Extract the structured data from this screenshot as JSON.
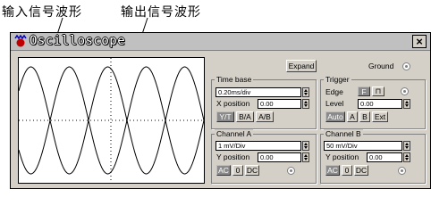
{
  "annotations": {
    "input_signal": "输入信号波形",
    "output_signal": "输出信号波形"
  },
  "window": {
    "title": "Oscilloscope",
    "close_label": "×"
  },
  "top": {
    "expand_label": "Expand",
    "ground_label": "Ground"
  },
  "timebase": {
    "title": "Time base",
    "value": "0.20ms/div",
    "x_position_label": "X position",
    "x_position_value": "0.00",
    "modes": [
      "Y/T",
      "B/A",
      "A/B"
    ],
    "active_mode": "Y/T"
  },
  "trigger": {
    "title": "Trigger",
    "edge_label": "Edge",
    "edge_rising": "F",
    "edge_falling": "⊓",
    "level_label": "Level",
    "level_value": "0.00",
    "sources": [
      "Auto",
      "A",
      "B",
      "Ext"
    ],
    "active_source": "Auto"
  },
  "channel_a": {
    "title": "Channel A",
    "value": "1 mV/Div",
    "y_position_label": "Y position",
    "y_position_value": "0.00",
    "couplings": [
      "AC",
      "0",
      "DC"
    ],
    "active_coupling": "AC"
  },
  "channel_b": {
    "title": "Channel B",
    "value": "50 mV/Div",
    "y_position_label": "Y position",
    "y_position_value": "0.00",
    "couplings": [
      "AC",
      "0",
      "DC"
    ],
    "active_coupling": "AC"
  },
  "colors": {
    "window_bg": "#d4d0c8",
    "screen_bg": "#ffffff",
    "trace": "#000000"
  }
}
